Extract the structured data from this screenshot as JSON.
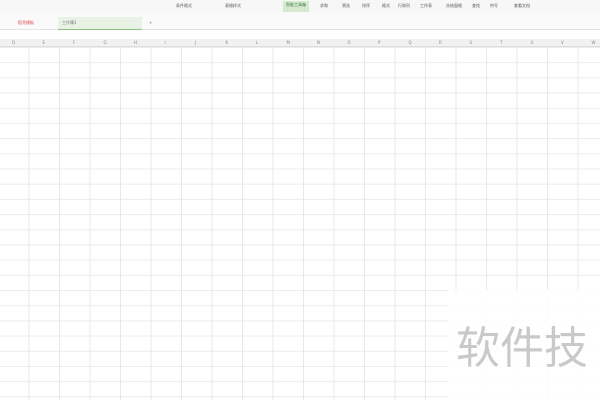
{
  "ribbon": {
    "items": [
      "条件格式",
      "表格样式",
      "智能工具箱",
      "求和",
      "筛选",
      "排序",
      "格式",
      "行和列",
      "工作表",
      "冻结窗格",
      "查找",
      "符号",
      "查看文档"
    ]
  },
  "tabs": [
    {
      "label": "稻壳模板"
    },
    {
      "label": "工作簿1"
    }
  ],
  "columns": [
    "D",
    "E",
    "F",
    "G",
    "H",
    "I",
    "J",
    "K",
    "L",
    "M",
    "N",
    "O",
    "P",
    "Q",
    "R",
    "S",
    "T",
    "U",
    "V",
    "W"
  ],
  "watermark": "软件技"
}
